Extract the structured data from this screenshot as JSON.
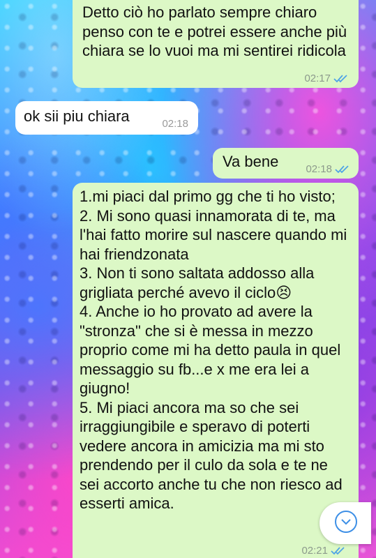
{
  "chat": {
    "messages": [
      {
        "direction": "outgoing",
        "text": "Detto ciò ho parlato sempre chiaro penso con te e potrei essere anche più chiara se lo vuoi ma mi sentirei ridicola",
        "time": "02:17",
        "status": "read"
      },
      {
        "direction": "incoming",
        "text": "ok sii piu chiara",
        "time": "02:18"
      },
      {
        "direction": "outgoing",
        "text": "Va bene",
        "time": "02:18",
        "status": "read"
      },
      {
        "direction": "outgoing",
        "lines": [
          "1.mi piaci dal primo gg che ti ho visto;",
          "2. Mi sono quasi innamorata di te, ma l'hai fatto morire sul nascere quando mi hai friendzonata",
          "3. Non ti sono saltata addosso alla grigliata perché avevo il ciclo😣",
          "4. Anche io ho provato ad avere la \"stronza\" che si è messa in mezzo proprio come mi ha detto paula in quel messaggio su fb...e x me era lei a giugno!",
          "5. Mi piaci ancora ma so che sei irraggiungibile e speravo di poterti vedere ancora in amicizia ma mi sto prendendo per il culo da sola e te ne sei accorto anche tu che non riesco ad esserti amica."
        ],
        "time": "02:21",
        "status": "read"
      }
    ],
    "scroll_button_icon": "chevron-down-icon"
  },
  "colors": {
    "outgoing_bubble": "#dcf8c6",
    "incoming_bubble": "#ffffff",
    "read_ticks": "#4fa3e6",
    "timestamp": "#8c9a8c"
  }
}
